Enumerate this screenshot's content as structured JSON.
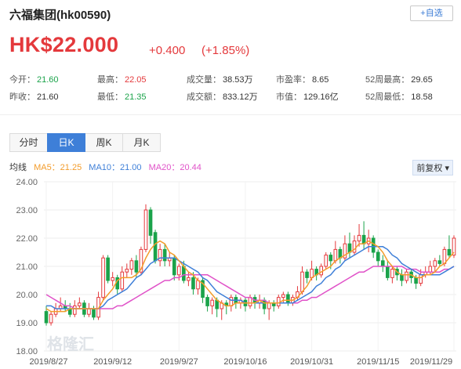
{
  "header": {
    "title": "六福集团(hk00590)",
    "add_fav_label": "+自选",
    "price": "HK$22.000",
    "change": "+0.400",
    "change_pct": "(+1.85%)"
  },
  "stats": {
    "open_label": "今开：",
    "open": "21.60",
    "prev_label": "昨收：",
    "prev": "21.60",
    "high_label": "最高：",
    "high": "22.05",
    "low_label": "最低：",
    "low": "21.35",
    "volume_label": "成交量：",
    "volume": "38.53万",
    "amount_label": "成交额：",
    "amount": "833.12万",
    "pe_label": "市盈率：",
    "pe": "8.65",
    "mcap_label": "市值：",
    "mcap": "129.16亿",
    "w52h_label": "52周最高：",
    "w52h": "29.65",
    "w52l_label": "52周最低：",
    "w52l": "18.58"
  },
  "tabs": [
    "分时",
    "日K",
    "周K",
    "月K"
  ],
  "legend": {
    "label": "均线",
    "ma5": "MA5：21.25",
    "ma10": "MA10：21.00",
    "ma20": "MA20：20.44",
    "adjust": "前复权 ▾"
  },
  "colors": {
    "up": "#e4393c",
    "down": "#1aa34a",
    "ma5": "#f39c2b",
    "ma10": "#3e7fd8",
    "ma20": "#e052c8",
    "accent": "#3e7fd8"
  },
  "watermark": "格隆汇",
  "chart_data": {
    "type": "candlestick",
    "y_ticks": [
      "24.00",
      "23.00",
      "22.00",
      "21.00",
      "20.00",
      "19.00",
      "18.00"
    ],
    "ylim": [
      18,
      24
    ],
    "x_ticks": [
      "2019/8/27",
      "2019/9/12",
      "2019/9/27",
      "2019/10/16",
      "2019/10/31",
      "2019/11/15",
      "2019/11/29"
    ],
    "candles": [
      [
        19.4,
        19.0,
        19.6,
        18.9
      ],
      [
        19.0,
        19.3,
        19.4,
        18.9
      ],
      [
        19.3,
        19.5,
        19.7,
        19.2
      ],
      [
        19.5,
        19.6,
        19.9,
        19.4
      ],
      [
        19.6,
        19.5,
        19.8,
        19.4
      ],
      [
        19.5,
        19.3,
        19.7,
        19.2
      ],
      [
        19.3,
        19.6,
        19.8,
        19.2
      ],
      [
        19.6,
        19.7,
        19.9,
        19.5
      ],
      [
        19.7,
        19.3,
        19.8,
        19.2
      ],
      [
        19.3,
        19.5,
        19.7,
        19.2
      ],
      [
        19.5,
        19.2,
        19.6,
        19.1
      ],
      [
        19.2,
        19.9,
        20.1,
        19.1
      ],
      [
        19.9,
        21.3,
        21.4,
        19.8
      ],
      [
        21.3,
        20.5,
        21.4,
        20.4
      ],
      [
        20.5,
        20.6,
        20.8,
        20.3
      ],
      [
        20.6,
        20.2,
        20.7,
        20.0
      ],
      [
        20.2,
        20.8,
        21.0,
        20.1
      ],
      [
        20.8,
        20.9,
        21.1,
        20.6
      ],
      [
        20.9,
        21.2,
        21.3,
        20.7
      ],
      [
        21.2,
        20.8,
        21.4,
        20.6
      ],
      [
        20.8,
        21.6,
        21.7,
        20.7
      ],
      [
        21.6,
        23.0,
        23.2,
        21.5
      ],
      [
        23.0,
        22.1,
        23.1,
        21.8
      ],
      [
        22.2,
        21.2,
        22.3,
        21.1
      ],
      [
        21.2,
        21.6,
        21.8,
        21.0
      ],
      [
        21.6,
        21.2,
        21.8,
        21.0
      ],
      [
        21.2,
        21.3,
        21.5,
        21.0
      ],
      [
        21.3,
        20.7,
        21.4,
        20.5
      ],
      [
        20.7,
        21.0,
        21.1,
        20.5
      ],
      [
        21.0,
        20.5,
        21.2,
        20.4
      ],
      [
        20.5,
        20.6,
        20.8,
        20.3
      ],
      [
        20.6,
        20.2,
        20.8,
        20.0
      ],
      [
        20.2,
        20.5,
        20.6,
        20.0
      ],
      [
        20.5,
        19.9,
        20.6,
        19.7
      ],
      [
        19.9,
        19.6,
        20.0,
        19.4
      ],
      [
        19.6,
        19.8,
        19.9,
        19.3
      ],
      [
        19.8,
        19.5,
        19.9,
        19.2
      ],
      [
        19.5,
        19.7,
        19.8,
        19.1
      ],
      [
        19.7,
        19.6,
        19.8,
        19.3
      ],
      [
        19.6,
        19.9,
        20.0,
        19.4
      ],
      [
        19.9,
        19.7,
        20.0,
        19.5
      ],
      [
        19.7,
        19.8,
        19.9,
        19.5
      ],
      [
        19.8,
        19.6,
        19.9,
        19.4
      ],
      [
        19.6,
        19.9,
        20.0,
        19.5
      ],
      [
        19.9,
        19.7,
        20.0,
        19.5
      ],
      [
        19.7,
        19.8,
        20.0,
        19.5
      ],
      [
        19.8,
        19.5,
        19.9,
        19.3
      ],
      [
        19.5,
        19.7,
        19.8,
        19.1
      ],
      [
        19.7,
        19.6,
        19.8,
        19.4
      ],
      [
        19.6,
        19.9,
        20.0,
        19.5
      ],
      [
        19.9,
        20.0,
        20.1,
        19.7
      ],
      [
        20.0,
        19.7,
        20.1,
        19.6
      ],
      [
        19.7,
        19.9,
        20.0,
        19.6
      ],
      [
        19.9,
        20.1,
        20.3,
        19.8
      ],
      [
        20.1,
        20.8,
        21.0,
        20.0
      ],
      [
        20.8,
        20.6,
        20.9,
        20.4
      ],
      [
        20.6,
        20.9,
        21.2,
        20.5
      ],
      [
        20.9,
        20.7,
        21.0,
        20.5
      ],
      [
        20.7,
        21.0,
        21.1,
        20.6
      ],
      [
        21.0,
        21.4,
        21.5,
        20.9
      ],
      [
        21.4,
        21.2,
        21.5,
        20.9
      ],
      [
        21.2,
        21.6,
        21.9,
        21.1
      ],
      [
        21.6,
        21.3,
        21.7,
        21.1
      ],
      [
        21.3,
        21.8,
        22.1,
        21.2
      ],
      [
        21.8,
        21.5,
        22.2,
        21.3
      ],
      [
        21.5,
        21.9,
        22.1,
        21.4
      ],
      [
        21.9,
        22.1,
        22.5,
        21.7
      ],
      [
        22.1,
        21.8,
        22.6,
        21.6
      ],
      [
        21.8,
        22.0,
        22.3,
        21.5
      ],
      [
        22.0,
        21.5,
        22.1,
        21.3
      ],
      [
        21.5,
        21.2,
        21.6,
        21.0
      ],
      [
        21.2,
        21.0,
        21.4,
        20.8
      ],
      [
        21.0,
        20.6,
        21.2,
        20.5
      ],
      [
        20.6,
        20.9,
        21.0,
        20.4
      ],
      [
        20.9,
        20.7,
        21.0,
        20.5
      ],
      [
        20.7,
        20.5,
        20.9,
        20.3
      ],
      [
        20.5,
        20.8,
        20.9,
        20.4
      ],
      [
        20.8,
        20.6,
        20.9,
        20.4
      ],
      [
        20.6,
        20.4,
        20.7,
        20.2
      ],
      [
        20.4,
        20.7,
        20.9,
        20.3
      ],
      [
        20.7,
        20.8,
        21.0,
        20.6
      ],
      [
        20.8,
        21.0,
        21.2,
        20.7
      ],
      [
        21.0,
        21.2,
        21.3,
        20.8
      ],
      [
        21.2,
        21.1,
        21.4,
        21.0
      ],
      [
        21.1,
        21.6,
        21.7,
        21.0
      ],
      [
        21.6,
        21.4,
        22.1,
        21.3
      ],
      [
        21.4,
        22.0,
        22.1,
        21.3
      ]
    ],
    "ma5": [
      19.5,
      19.4,
      19.4,
      19.4,
      19.4,
      19.5,
      19.5,
      19.5,
      19.5,
      19.5,
      19.5,
      19.5,
      19.8,
      20.0,
      20.2,
      20.5,
      20.6,
      20.6,
      20.6,
      20.7,
      20.9,
      21.3,
      21.6,
      21.8,
      21.9,
      21.8,
      21.5,
      21.4,
      21.2,
      21.0,
      20.8,
      20.7,
      20.5,
      20.4,
      20.2,
      20.0,
      19.8,
      19.7,
      19.6,
      19.6,
      19.7,
      19.7,
      19.7,
      19.7,
      19.7,
      19.8,
      19.7,
      19.7,
      19.7,
      19.7,
      19.8,
      19.8,
      19.8,
      19.9,
      20.1,
      20.3,
      20.6,
      20.7,
      20.8,
      20.9,
      21.0,
      21.2,
      21.3,
      21.4,
      21.5,
      21.6,
      21.8,
      21.8,
      21.9,
      21.8,
      21.7,
      21.5,
      21.2,
      21.0,
      20.8,
      20.7,
      20.7,
      20.7,
      20.6,
      20.6,
      20.7,
      20.7,
      20.8,
      21.0,
      21.1,
      21.3,
      21.5
    ],
    "ma10": [
      19.6,
      19.6,
      19.5,
      19.5,
      19.5,
      19.5,
      19.5,
      19.5,
      19.5,
      19.5,
      19.5,
      19.5,
      19.6,
      19.8,
      19.9,
      20.0,
      20.1,
      20.2,
      20.4,
      20.6,
      20.7,
      20.9,
      21.1,
      21.2,
      21.3,
      21.3,
      21.3,
      21.3,
      21.2,
      21.1,
      21.0,
      20.9,
      20.8,
      20.6,
      20.5,
      20.3,
      20.1,
      20.0,
      19.9,
      19.8,
      19.8,
      19.8,
      19.7,
      19.7,
      19.7,
      19.7,
      19.7,
      19.7,
      19.7,
      19.7,
      19.7,
      19.7,
      19.7,
      19.8,
      19.9,
      20.0,
      20.1,
      20.3,
      20.4,
      20.6,
      20.7,
      20.9,
      21.0,
      21.2,
      21.3,
      21.4,
      21.5,
      21.6,
      21.7,
      21.7,
      21.7,
      21.7,
      21.6,
      21.4,
      21.3,
      21.1,
      21.0,
      20.9,
      20.8,
      20.7,
      20.7,
      20.7,
      20.7,
      20.7,
      20.8,
      20.9,
      21.0
    ],
    "ma20": [
      20.0,
      19.9,
      19.8,
      19.7,
      19.6,
      19.6,
      19.5,
      19.5,
      19.5,
      19.5,
      19.5,
      19.5,
      19.5,
      19.5,
      19.5,
      19.6,
      19.6,
      19.7,
      19.8,
      19.9,
      20.0,
      20.1,
      20.2,
      20.3,
      20.4,
      20.5,
      20.5,
      20.6,
      20.6,
      20.7,
      20.7,
      20.7,
      20.7,
      20.7,
      20.7,
      20.6,
      20.5,
      20.4,
      20.3,
      20.2,
      20.1,
      20.0,
      19.9,
      19.9,
      19.8,
      19.8,
      19.8,
      19.7,
      19.7,
      19.7,
      19.7,
      19.7,
      19.7,
      19.7,
      19.8,
      19.8,
      19.9,
      19.9,
      20.0,
      20.1,
      20.2,
      20.3,
      20.4,
      20.5,
      20.6,
      20.7,
      20.8,
      20.8,
      20.9,
      21.0,
      21.0,
      21.0,
      21.0,
      21.0,
      21.0,
      21.0,
      20.9,
      20.9,
      20.9,
      20.8,
      20.8,
      20.8,
      20.8,
      20.8,
      20.9,
      20.9,
      21.0
    ]
  }
}
